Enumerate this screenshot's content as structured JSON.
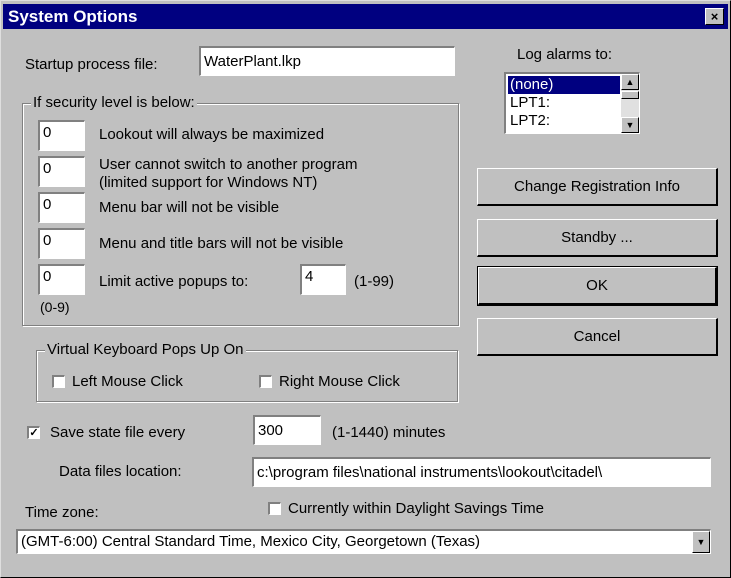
{
  "window": {
    "title": "System Options",
    "close_glyph": "×"
  },
  "startup": {
    "label": "Startup process file:",
    "value": "WaterPlant.lkp"
  },
  "log_alarms": {
    "label": "Log alarms to:",
    "items": [
      "(none)",
      "LPT1:",
      "LPT2:"
    ],
    "selected": "(none)"
  },
  "security": {
    "legend": "If security level is below:",
    "rows": [
      {
        "value": "0",
        "label": "Lookout will always be maximized"
      },
      {
        "value": "0",
        "label": "User cannot switch to another program",
        "label2": "(limited support for Windows NT)"
      },
      {
        "value": "0",
        "label": "Menu bar will not be visible"
      },
      {
        "value": "0",
        "label": "Menu and title bars will not be visible"
      },
      {
        "value": "0",
        "label": "Limit active popups to:"
      }
    ],
    "range_hint": "(0-9)",
    "popups_value": "4",
    "popups_range": "(1-99)"
  },
  "buttons": {
    "change_registration": "Change Registration Info",
    "standby": "Standby ...",
    "ok": "OK",
    "cancel": "Cancel"
  },
  "virtual_keyboard": {
    "legend": "Virtual Keyboard Pops Up On",
    "left_click": {
      "label": "Left Mouse Click",
      "checked": false
    },
    "right_click": {
      "label": "Right Mouse Click",
      "checked": false
    }
  },
  "save_state": {
    "label": "Save state file every",
    "checked": true,
    "check_glyph": "✓",
    "value": "300",
    "suffix": "(1-1440) minutes"
  },
  "data_files": {
    "label": "Data files location:",
    "value": "c:\\program files\\national instruments\\lookout\\citadel\\"
  },
  "time_zone": {
    "label": "Time zone:",
    "value": "(GMT-6:00) Central Standard Time, Mexico City, Georgetown (Texas)",
    "dst": {
      "label": "Currently within Daylight Savings Time",
      "checked": false
    }
  }
}
